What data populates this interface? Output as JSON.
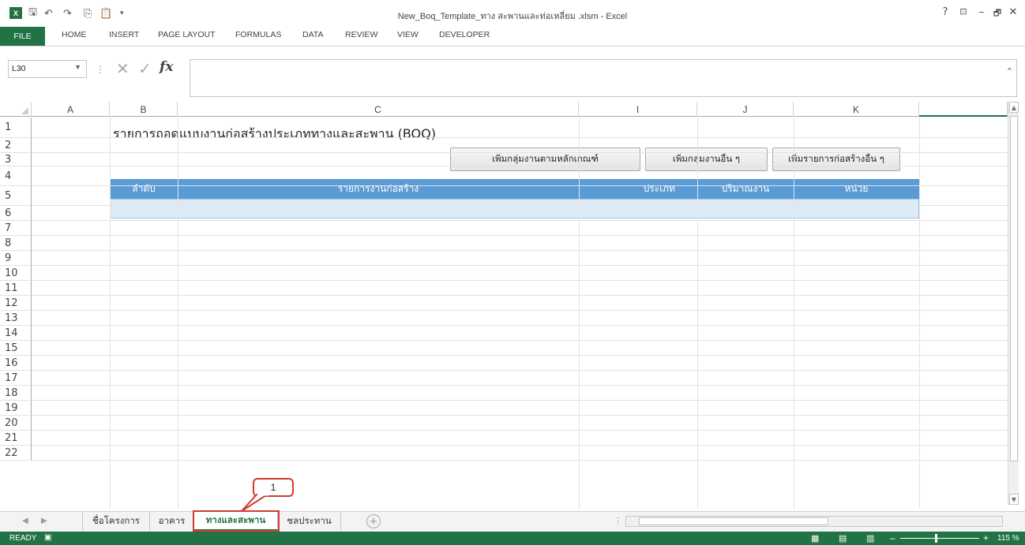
{
  "window": {
    "title": "New_Boq_Template_ทาง สะพานและท่อเหลี่ยม .xlsm - Excel",
    "help": "?",
    "ribbon_display": "⊡",
    "minimize": "–",
    "restore": "🗗",
    "close": "✕"
  },
  "ribbon": {
    "tabs": [
      "FILE",
      "HOME",
      "INSERT",
      "PAGE LAYOUT",
      "FORMULAS",
      "DATA",
      "REVIEW",
      "VIEW",
      "DEVELOPER"
    ]
  },
  "formula_bar": {
    "name_box": "L30",
    "formula": ""
  },
  "columns": [
    "A",
    "B",
    "C",
    "I",
    "J",
    "K"
  ],
  "rows": [
    "1",
    "2",
    "3",
    "4",
    "5",
    "6",
    "7",
    "8",
    "9",
    "10",
    "11",
    "12",
    "13",
    "14",
    "15",
    "16",
    "17",
    "18",
    "19",
    "20",
    "21",
    "22"
  ],
  "sheet": {
    "title": "รายการถอดแบบงานก่อสร้างประเภททางและสะพาน (BOQ)",
    "buttons": [
      "เพิ่มกลุ่มงานตามหลักเกณฑ์",
      "เพิ่มกลุ่มงานอื่น ๆ",
      "เพิ่มรายการก่อสร้างอื่น ๆ"
    ],
    "table_headers": [
      "ลำดับ",
      "รายการงานก่อสร้าง",
      "ประเภท",
      "ปริมาณงาน",
      "หน่วย"
    ]
  },
  "callout": "1",
  "sheet_tabs": [
    "ชื่อโครงการ",
    "อาคาร",
    "ทางและสะพาน",
    "ชลประทาน"
  ],
  "active_sheet": "ทางและสะพาน",
  "status": {
    "mode": "READY",
    "zoom": "115 %"
  },
  "colors": {
    "excel_green": "#217346",
    "table_header": "#5b9bd5",
    "row_highlight": "#ddebf7",
    "callout_red": "#d03c2e"
  }
}
